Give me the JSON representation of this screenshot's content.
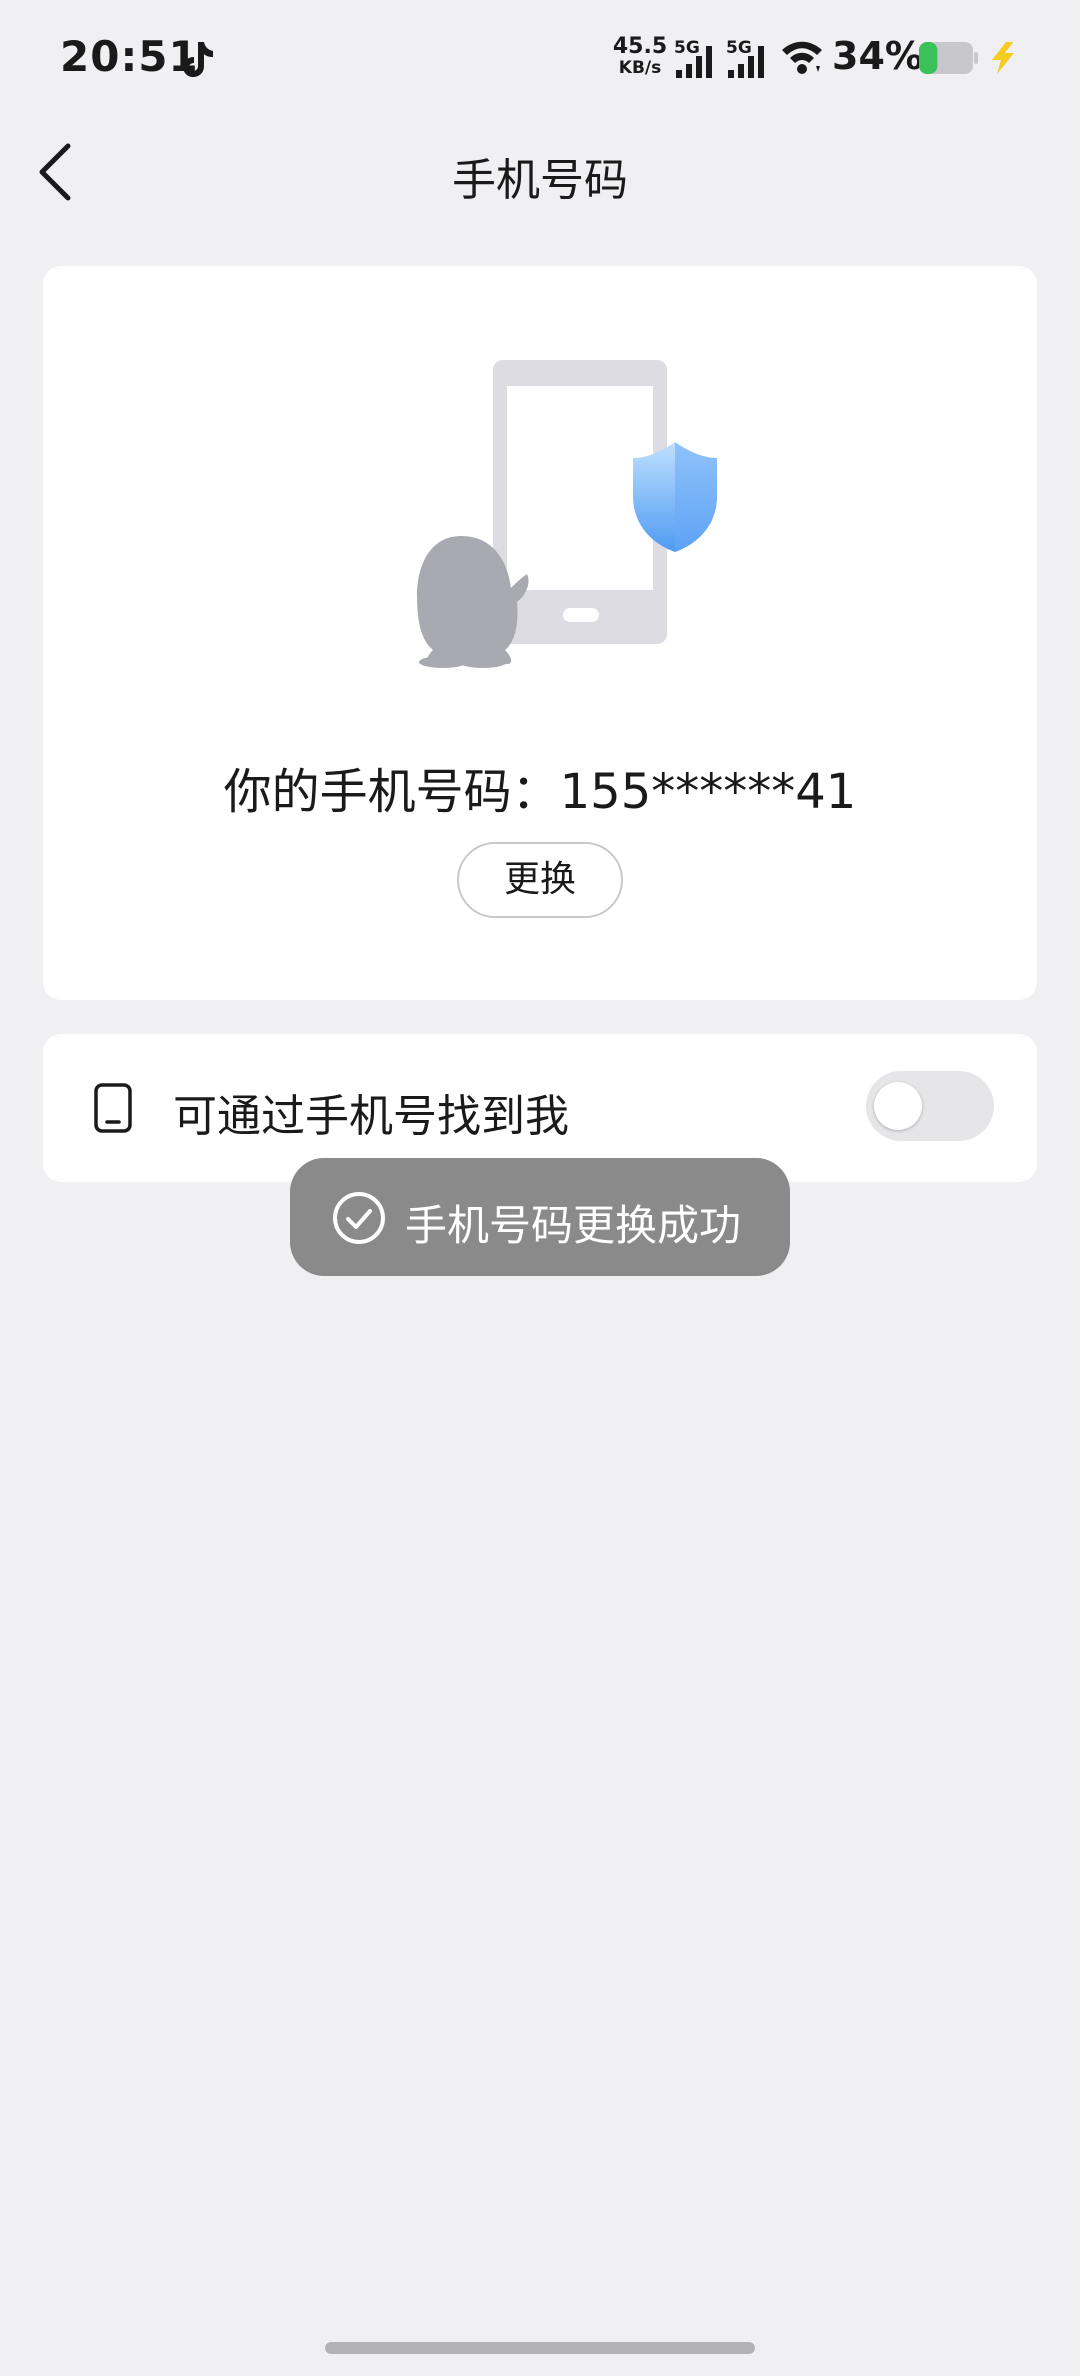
{
  "status_bar": {
    "time": "20:51",
    "net_speed_value": "45.5",
    "net_speed_unit": "KB/s",
    "sim1_tag": "5G",
    "sim2_tag": "5G",
    "battery_percent": "34%",
    "battery_level": 0.34,
    "battery_color": "#3ac15a",
    "charging_color": "#f5cc1f"
  },
  "header": {
    "title": "手机号码"
  },
  "phone_card": {
    "phone_text": "你的手机号码：155******41",
    "change_button_label": "更换"
  },
  "discover_card": {
    "label": "可通过手机号找到我",
    "toggle_on": false
  },
  "toast": {
    "message": "手机号码更换成功"
  },
  "colors": {
    "background": "#f0f0f2",
    "card": "#ffffff",
    "toast_bg": "#8a8a8a",
    "shield_blue": "#4f9bf2"
  }
}
